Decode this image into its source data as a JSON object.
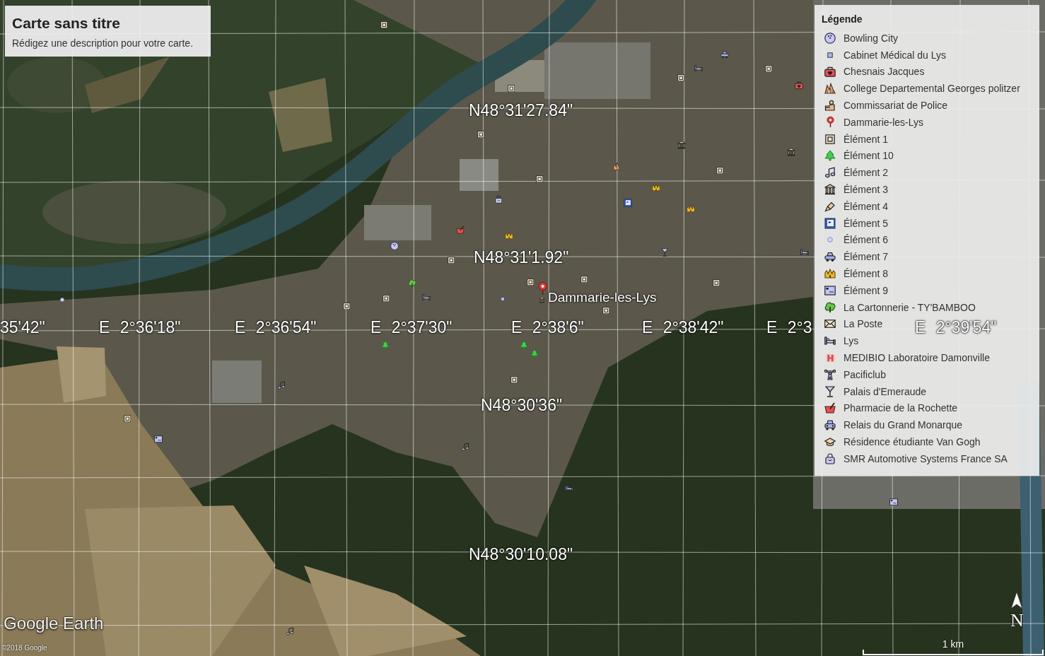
{
  "title_panel": {
    "title": "Carte sans titre",
    "description": "Rédigez une description pour votre carte."
  },
  "map": {
    "longitude_labels": [
      "35'42\"",
      "E 2°36'18\"",
      "E 2°36'54\"",
      "E 2°37'30\"",
      "E 2°38'6\"",
      "E 2°38'42\"",
      "E 2°3",
      "E 2°39'54\""
    ],
    "latitude_labels": [
      "N48°31'27.84\"",
      "N48°31'1.92\"",
      "N48°30'36\"",
      "N48°30'10.08\""
    ],
    "placemark_label": "Dammarie-les-Lys"
  },
  "legend": {
    "title": "Légende",
    "items": [
      {
        "label": "Bowling City",
        "kind": "bowling"
      },
      {
        "label": "Cabinet Médical du Lys",
        "kind": "square"
      },
      {
        "label": "Chesnais Jacques",
        "kind": "medkit"
      },
      {
        "label": "College Departemental Georges politzer",
        "kind": "campus"
      },
      {
        "label": "Commissariat de Police",
        "kind": "police"
      },
      {
        "label": "Dammarie-les-Lys",
        "kind": "pin"
      },
      {
        "label": "Élément 1",
        "kind": "frame"
      },
      {
        "label": "Élément 10",
        "kind": "tree"
      },
      {
        "label": "Élément 2",
        "kind": "music"
      },
      {
        "label": "Élément 3",
        "kind": "museum"
      },
      {
        "label": "Élément 4",
        "kind": "brush"
      },
      {
        "label": "Élément 5",
        "kind": "flag"
      },
      {
        "label": "Élément 6",
        "kind": "dot"
      },
      {
        "label": "Élément 7",
        "kind": "car"
      },
      {
        "label": "Élément 8",
        "kind": "castle"
      },
      {
        "label": "Élément 9",
        "kind": "screen"
      },
      {
        "label": "La Cartonnerie - TY'BAMBOO",
        "kind": "park"
      },
      {
        "label": "La Poste",
        "kind": "mail"
      },
      {
        "label": "Lys",
        "kind": "bed"
      },
      {
        "label": "MEDIBIO Laboratoire Damonville",
        "kind": "hospital"
      },
      {
        "label": "Pacificlub",
        "kind": "gym"
      },
      {
        "label": "Palais d'Emeraude",
        "kind": "bar"
      },
      {
        "label": "Pharmacie de la Rochette",
        "kind": "pharmacy"
      },
      {
        "label": "Relais du Grand Monarque",
        "kind": "taxi"
      },
      {
        "label": "Résidence étudiante Van Gogh",
        "kind": "gradcap"
      },
      {
        "label": "SMR Automotive Systems France SA",
        "kind": "bag"
      }
    ]
  },
  "logo": "Google Earth",
  "copyright": "©2018 Google",
  "scale_bar": {
    "label": "1 km"
  },
  "compass": {
    "label": "N"
  }
}
